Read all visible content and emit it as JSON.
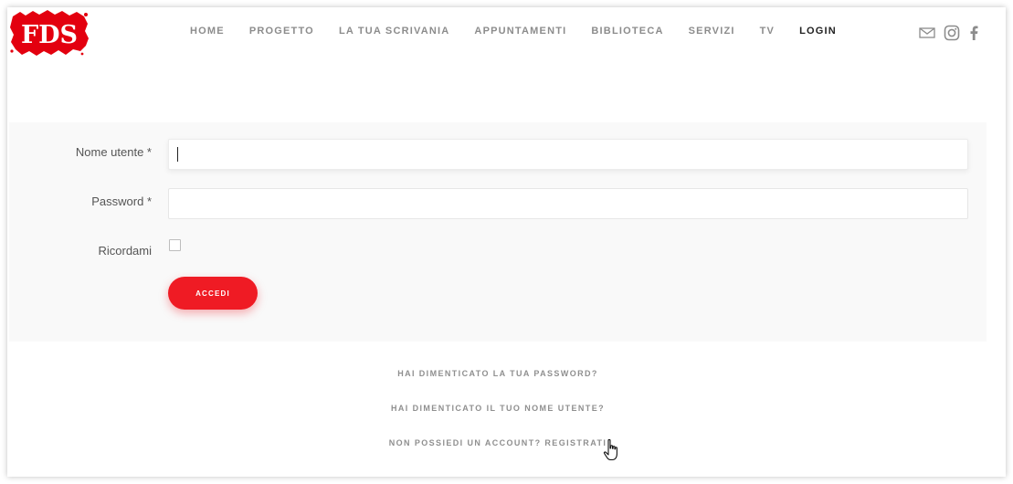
{
  "brand": {
    "logo_text": "FDS",
    "logo_color": "#e3000f"
  },
  "nav": {
    "items": [
      {
        "label": "HOME"
      },
      {
        "label": "PROGETTO"
      },
      {
        "label": "LA TUA SCRIVANIA"
      },
      {
        "label": "APPUNTAMENTI"
      },
      {
        "label": "BIBLIOTECA"
      },
      {
        "label": "SERVIZI"
      },
      {
        "label": "TV"
      },
      {
        "label": "LOGIN",
        "active": true
      }
    ]
  },
  "social": {
    "icons": [
      "mail-icon",
      "instagram-icon",
      "facebook-icon"
    ],
    "color": "#8c8c8c"
  },
  "form": {
    "username_label": "Nome utente *",
    "username_value": "",
    "password_label": "Password *",
    "password_value": "",
    "remember_label": "Ricordami",
    "remember_checked": false,
    "submit_label": "ACCEDI",
    "accent_color": "#ef1b24"
  },
  "links": {
    "forgot_password": "HAI DIMENTICATO LA TUA PASSWORD?",
    "forgot_username": "HAI DIMENTICATO IL TUO NOME UTENTE?",
    "register": "NON POSSIEDI UN ACCOUNT? REGISTRATI"
  }
}
